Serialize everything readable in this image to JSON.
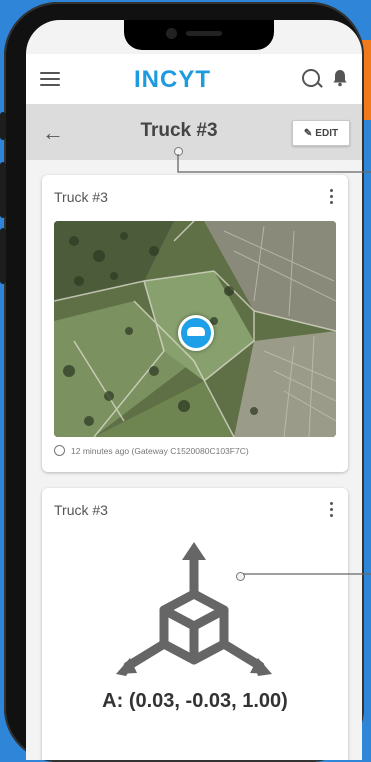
{
  "app": {
    "logo": "INCYT"
  },
  "titlebar": {
    "title": "Truck #3",
    "edit_label": "EDIT"
  },
  "location_card": {
    "title": "Truck #3",
    "timestamp": "12 minutes ago (Gateway C1520080C103F7C)"
  },
  "accelerometer_card": {
    "title": "Truck #3",
    "value": "A: (0.03, -0.03, 1.00)"
  },
  "colors": {
    "accent": "#1d9be0",
    "background": "#2f86d8",
    "titlebar": "#dcdcdc",
    "orange": "#f07a1c"
  }
}
